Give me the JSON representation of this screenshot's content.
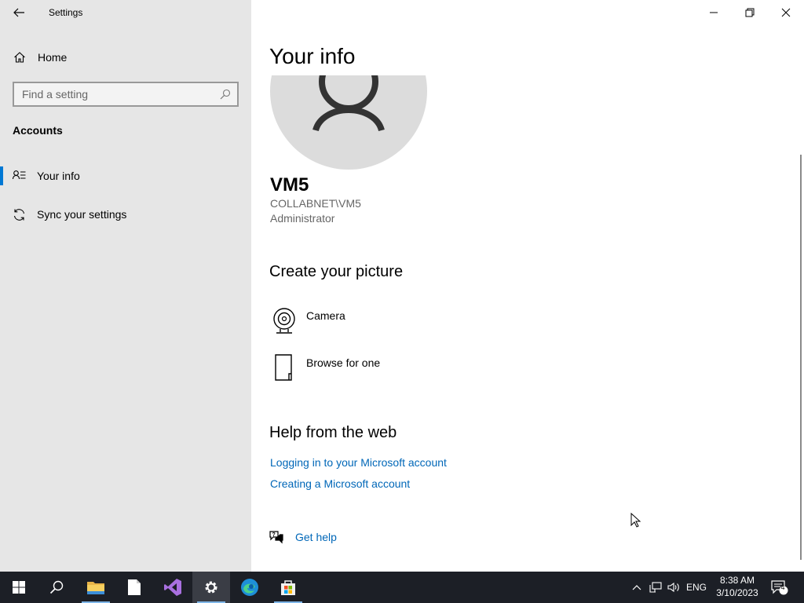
{
  "window": {
    "title": "Settings"
  },
  "sidebar": {
    "home_label": "Home",
    "search_placeholder": "Find a setting",
    "section_title": "Accounts",
    "items": [
      {
        "label": "Your info",
        "icon": "person-list-icon",
        "active": true
      },
      {
        "label": "Sync your settings",
        "icon": "sync-icon",
        "active": false
      }
    ]
  },
  "main": {
    "page_title": "Your info",
    "user": {
      "name": "VM5",
      "account": "COLLABNET\\VM5",
      "role": "Administrator"
    },
    "create_picture": {
      "heading": "Create your picture",
      "options": [
        {
          "label": "Camera",
          "icon": "camera-icon"
        },
        {
          "label": "Browse for one",
          "icon": "document-icon"
        }
      ]
    },
    "help": {
      "heading": "Help from the web",
      "links": [
        "Logging in to your Microsoft account",
        "Creating a Microsoft account"
      ],
      "get_help_label": "Get help"
    }
  },
  "taskbar": {
    "tray": {
      "language": "ENG",
      "notification_count": "4"
    },
    "clock": {
      "time": "8:38 AM",
      "date": "3/10/2023"
    }
  },
  "colors": {
    "accent": "#0078d4",
    "link": "#0067b8",
    "sidebar_bg": "#e6e6e6",
    "taskbar_bg": "#1c1f26"
  }
}
